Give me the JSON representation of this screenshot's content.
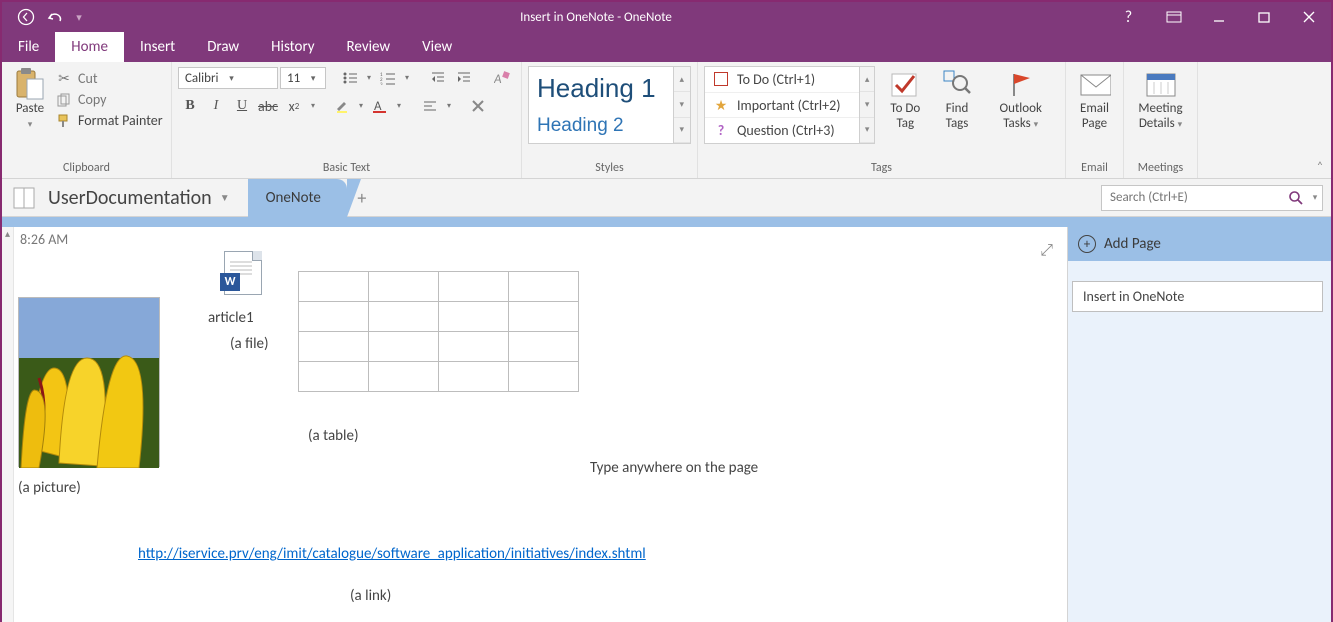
{
  "window": {
    "title": "Insert in OneNote - OneNote"
  },
  "tabs": {
    "file": "File",
    "home": "Home",
    "insert": "Insert",
    "draw": "Draw",
    "history": "History",
    "review": "Review",
    "view": "View"
  },
  "ribbon": {
    "clipboard": {
      "label": "Clipboard",
      "paste": "Paste",
      "cut": "Cut",
      "copy": "Copy",
      "format_painter": "Format Painter"
    },
    "basic_text": {
      "label": "Basic Text",
      "font": "Calibri",
      "size": "11"
    },
    "styles": {
      "label": "Styles",
      "h1": "Heading 1",
      "h2": "Heading 2"
    },
    "tags": {
      "label": "Tags",
      "items": [
        {
          "label": "To Do (Ctrl+1)"
        },
        {
          "label": "Important (Ctrl+2)"
        },
        {
          "label": "Question (Ctrl+3)"
        }
      ],
      "todo": "To Do Tag",
      "find": "Find Tags",
      "outlook": "Outlook Tasks"
    },
    "email": {
      "label": "Email",
      "button": "Email Page"
    },
    "meetings": {
      "label": "Meetings",
      "button": "Meeting Details"
    }
  },
  "nav": {
    "notebook": "UserDocumentation",
    "section": "OneNote",
    "search_placeholder": "Search (Ctrl+E)"
  },
  "page": {
    "timestamp": "8:26 AM",
    "picture_caption": "(a picture)",
    "file_name": "article1",
    "file_caption": "(a file)",
    "table_caption": "(a table)",
    "hint": "Type anywhere on the page",
    "link_text": "http://iservice.prv/eng/imit/catalogue/software_application/initiatives/index.shtml",
    "link_caption": "(a link)"
  },
  "pagepane": {
    "add": "Add Page",
    "items": [
      "Insert in OneNote"
    ]
  }
}
